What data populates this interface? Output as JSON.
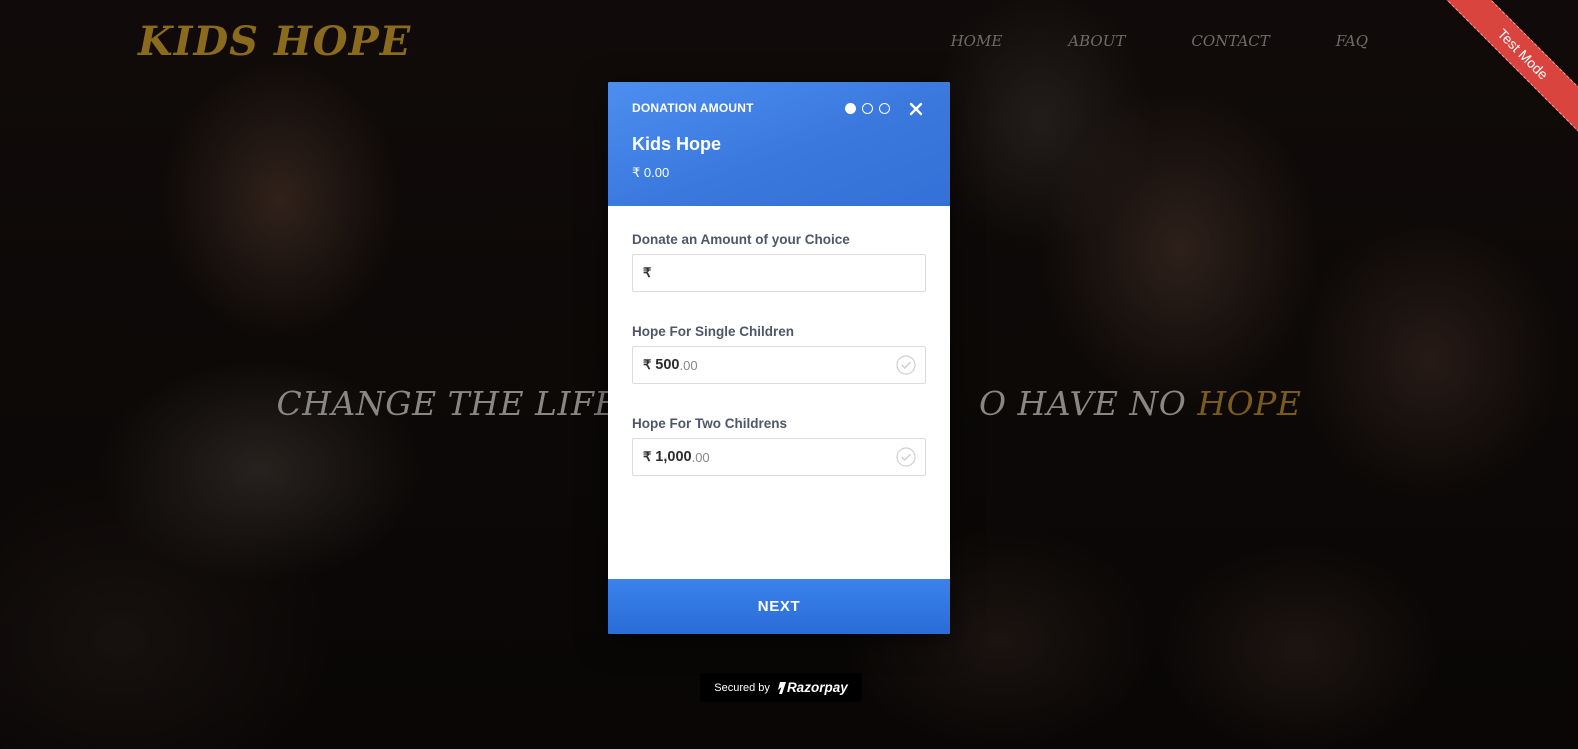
{
  "site": {
    "brand": "KIDS HOPE",
    "nav": [
      "HOME",
      "ABOUT",
      "CONTACT",
      "FAQ"
    ],
    "hero_left": "CHANGE THE LIFE",
    "hero_right": "O HAVE NO",
    "hero_accent": "HOPE",
    "ribbon": "Test Mode"
  },
  "modal": {
    "step_title": "DONATION AMOUNT",
    "steps_total": 3,
    "steps_active": 1,
    "merchant_name": "Kids Hope",
    "total_amount": "₹ 0.00",
    "fields": [
      {
        "label": "Donate an Amount of your Choice",
        "currency": "₹",
        "value": "",
        "placeholder": ""
      },
      {
        "label": "Hope For Single Children",
        "currency": "₹",
        "amount_main": "500",
        "amount_decimal": ".00"
      },
      {
        "label": "Hope For Two Childrens",
        "currency": "₹",
        "amount_main": "1,000",
        "amount_decimal": ".00"
      }
    ],
    "next_label": "NEXT"
  },
  "footer": {
    "secured_by": "Secured by",
    "provider": "Razorpay"
  },
  "colors": {
    "header_blue": "#3a78de",
    "brand_gold": "#8a6a1c",
    "ribbon_red": "#d9443f"
  },
  "icons": {
    "close": "close-icon",
    "check": "check-circle-icon",
    "razorpay": "razorpay-logo-icon"
  }
}
